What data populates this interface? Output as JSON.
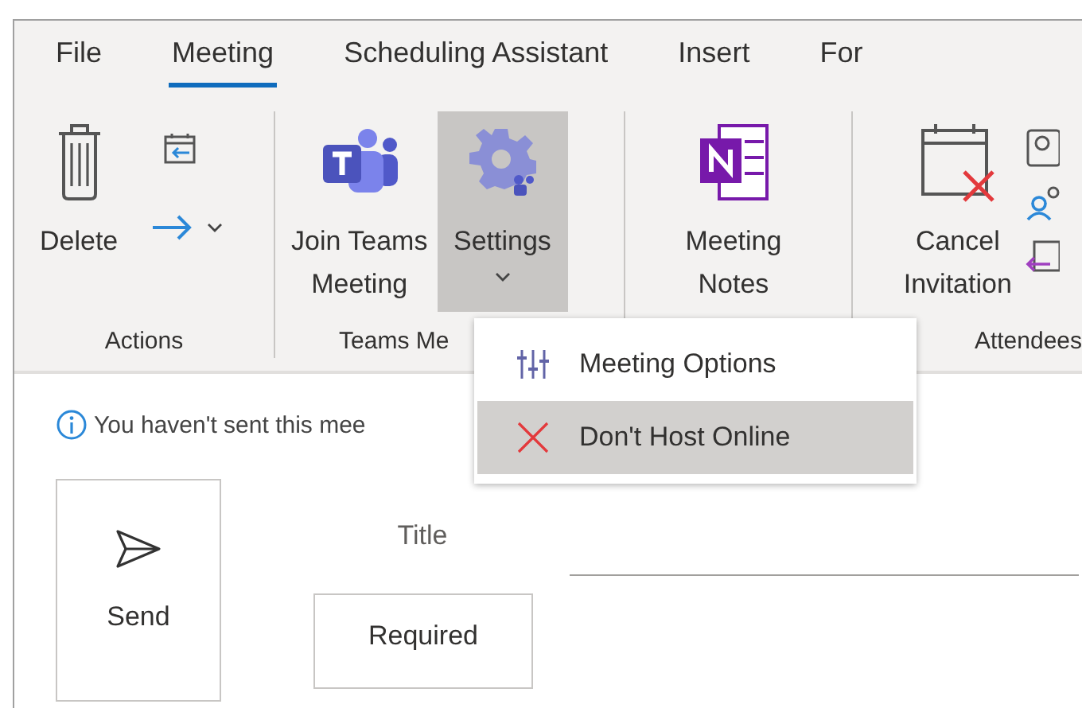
{
  "tabs": [
    {
      "label": "File",
      "selected": false
    },
    {
      "label": "Meeting",
      "selected": true
    },
    {
      "label": "Scheduling Assistant",
      "selected": false
    },
    {
      "label": "Insert",
      "selected": false
    },
    {
      "label": "For",
      "selected": false
    }
  ],
  "ribbon": {
    "groups": [
      {
        "label": "Actions",
        "buttons": [
          {
            "kind": "trash",
            "lines": [
              "Delete"
            ]
          },
          {
            "kind": "stack",
            "dropdown": true
          }
        ]
      },
      {
        "label": "Teams Me",
        "buttons": [
          {
            "kind": "teams",
            "lines": [
              "Join Teams",
              "Meeting"
            ]
          },
          {
            "kind": "gear",
            "lines": [
              "Settings"
            ],
            "dropdown": true,
            "pressed": true
          }
        ]
      },
      {
        "buttons": [
          {
            "kind": "notes",
            "lines": [
              "Meeting",
              "Notes"
            ]
          }
        ]
      },
      {
        "label": "Attendees",
        "buttons": [
          {
            "kind": "cancel",
            "lines": [
              "Cancel",
              "Invitation"
            ]
          },
          {
            "kind": "people"
          }
        ]
      }
    ]
  },
  "menu": {
    "items": [
      {
        "kind": "sliders",
        "label": "Meeting Options",
        "selected": false
      },
      {
        "kind": "cross",
        "label": "Don't Host Online",
        "selected": true
      }
    ]
  },
  "info": {
    "text": "You haven't sent this mee"
  },
  "send": {
    "label": "Send"
  },
  "form": {
    "title_label": "Title",
    "required_label": "Required"
  }
}
